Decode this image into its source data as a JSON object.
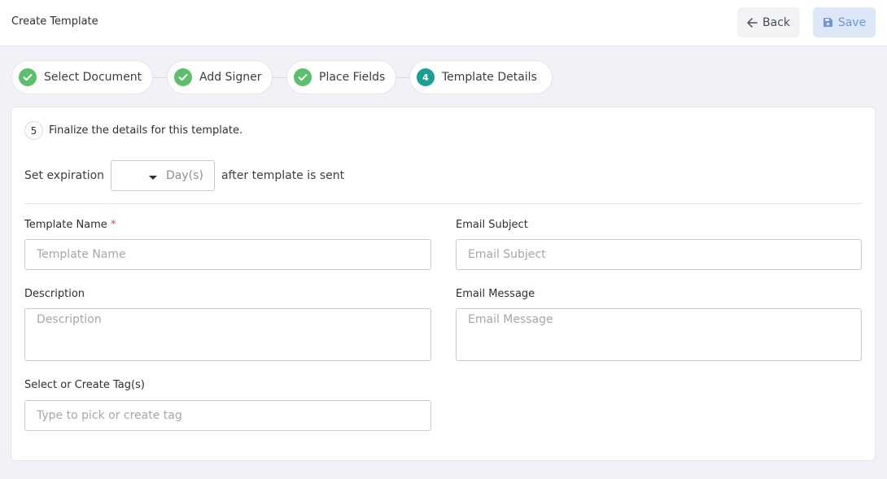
{
  "header": {
    "title": "Create Template",
    "back_label": "Back",
    "save_label": "Save"
  },
  "steps": [
    {
      "label": "Select Document",
      "status": "done"
    },
    {
      "label": "Add Signer",
      "status": "done"
    },
    {
      "label": "Place Fields",
      "status": "done"
    },
    {
      "label": "Template Details",
      "status": "active",
      "number": "4"
    }
  ],
  "section": {
    "number": "5",
    "title": "Finalize the details for this template."
  },
  "expiration": {
    "prefix": "Set expiration",
    "unit": "Day(s)",
    "suffix": "after template is sent"
  },
  "form": {
    "template_name": {
      "label": "Template Name",
      "required_mark": "*",
      "placeholder": "Template Name",
      "value": ""
    },
    "email_subject": {
      "label": "Email Subject",
      "placeholder": "Email Subject",
      "value": ""
    },
    "description": {
      "label": "Description",
      "placeholder": "Description",
      "value": ""
    },
    "email_message": {
      "label": "Email Message",
      "placeholder": "Email Message",
      "value": ""
    },
    "tags": {
      "label": "Select or Create Tag(s)",
      "placeholder": "Type to pick or create tag",
      "value": ""
    }
  },
  "colors": {
    "check": "#5cbf6b",
    "active_step": "#1b9e95",
    "save_bg": "#dce8f8",
    "required": "#e5484d"
  }
}
